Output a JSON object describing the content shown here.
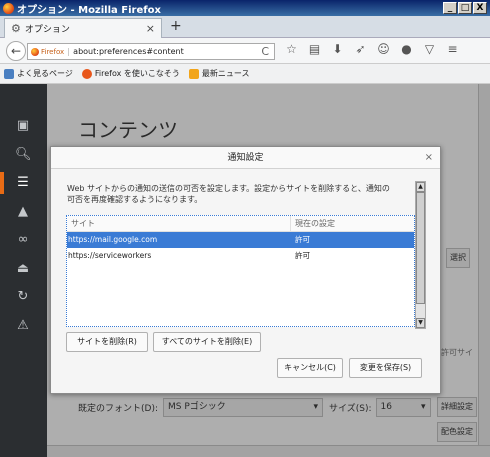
{
  "window": {
    "title": "オプション - Mozilla Firefox",
    "controls": [
      "_",
      "□",
      "X"
    ]
  },
  "tab": {
    "title": "オプション",
    "close": "×",
    "new": "+"
  },
  "nav": {
    "identity": "Firefox",
    "url": "about:preferences#content",
    "reload": "C"
  },
  "bookmarks": [
    {
      "label": "よく見るページ",
      "color": "#4a7fc1"
    },
    {
      "label": "Firefox を使いこなそう",
      "color": "#e8571b"
    },
    {
      "label": "最新ニュース",
      "color": "#f2a51a"
    }
  ],
  "page": {
    "heading": "コンテンツ",
    "choose_button": "選択",
    "allow_sites_text": "許可サイ",
    "default_font_label": "既定のフォント(D):",
    "default_font_value": "MS Pゴシック",
    "size_label": "サイズ(S):",
    "size_value": "16",
    "advanced_button": "詳細設定",
    "colors_button": "配色設定"
  },
  "dialog": {
    "title": "通知設定",
    "close": "×",
    "description": "Web サイトからの通知の送信の可否を設定します。設定からサイトを削除すると、通知の可否を再度確認するようになります。",
    "col_site": "サイト",
    "col_status": "現在の設定",
    "rows": [
      {
        "site": "https://mail.google.com",
        "status": "許可"
      },
      {
        "site": "https://serviceworkers",
        "status": "許可"
      }
    ],
    "remove_site": "サイトを削除(R)",
    "remove_all": "すべてのサイトを削除(E)",
    "cancel": "キャンセル(C)",
    "save": "変更を保存(S)"
  }
}
